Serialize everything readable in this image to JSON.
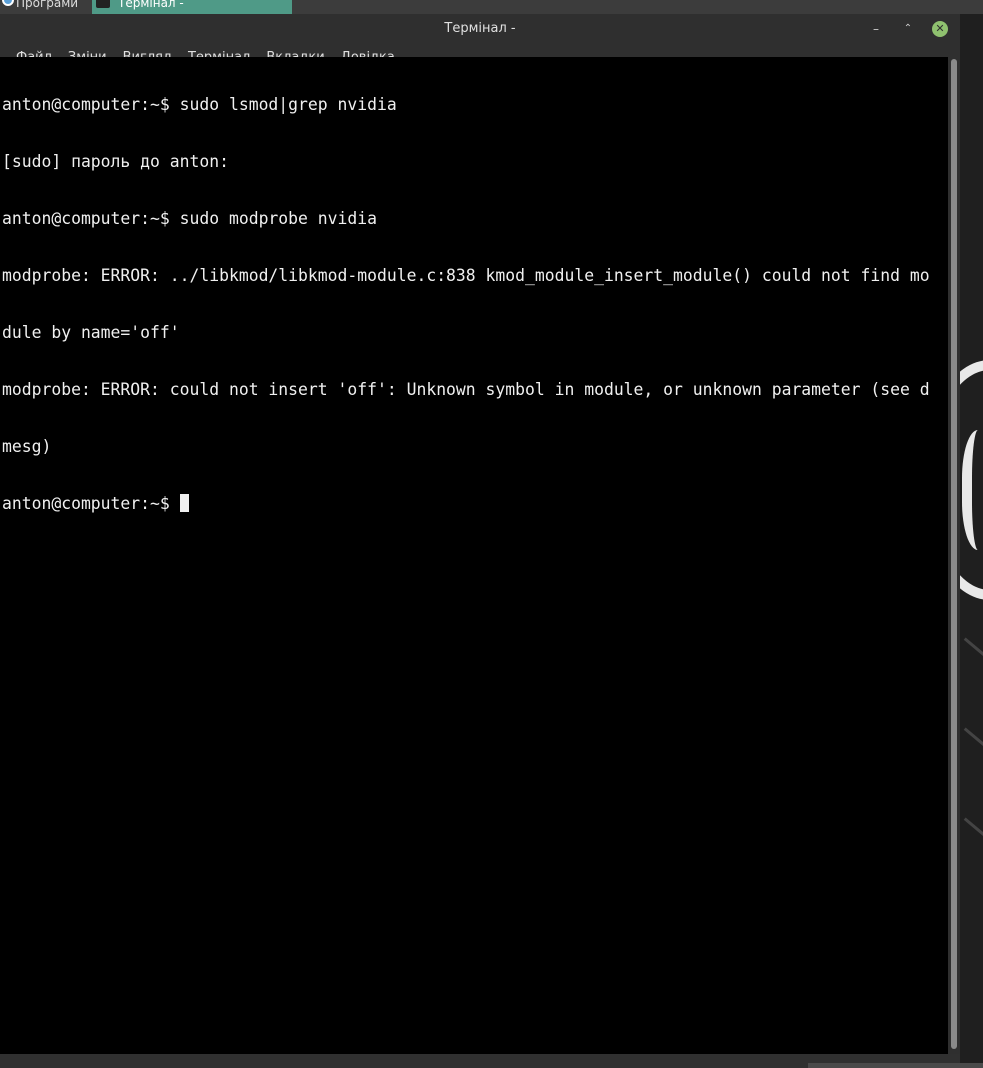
{
  "taskbar": {
    "apps_label": "Програми",
    "terminal_label": "Термінал -"
  },
  "window": {
    "title": "Термінал -",
    "buttons": {
      "minimize": "–",
      "maximize": "⌃",
      "close": "✕"
    }
  },
  "menu": {
    "items": [
      "Файл",
      "Зміни",
      "Вигляд",
      "Термінал",
      "Вкладки",
      "Довідка"
    ]
  },
  "terminal": {
    "lines": [
      "anton@computer:~$ sudo lsmod|grep nvidia",
      "[sudo] пароль до anton:",
      "anton@computer:~$ sudo modprobe nvidia",
      "modprobe: ERROR: ../libkmod/libkmod-module.c:838 kmod_module_insert_module() could not find mo",
      "dule by name='off'",
      "modprobe: ERROR: could not insert 'off': Unknown symbol in module, or unknown parameter (see d",
      "mesg)"
    ],
    "prompt": "anton@computer:~$ "
  },
  "colors": {
    "terminal_bg": "#000000",
    "terminal_fg": "#f0f0f0",
    "accent": "#4f9a87",
    "close_button": "#8fc16f"
  }
}
